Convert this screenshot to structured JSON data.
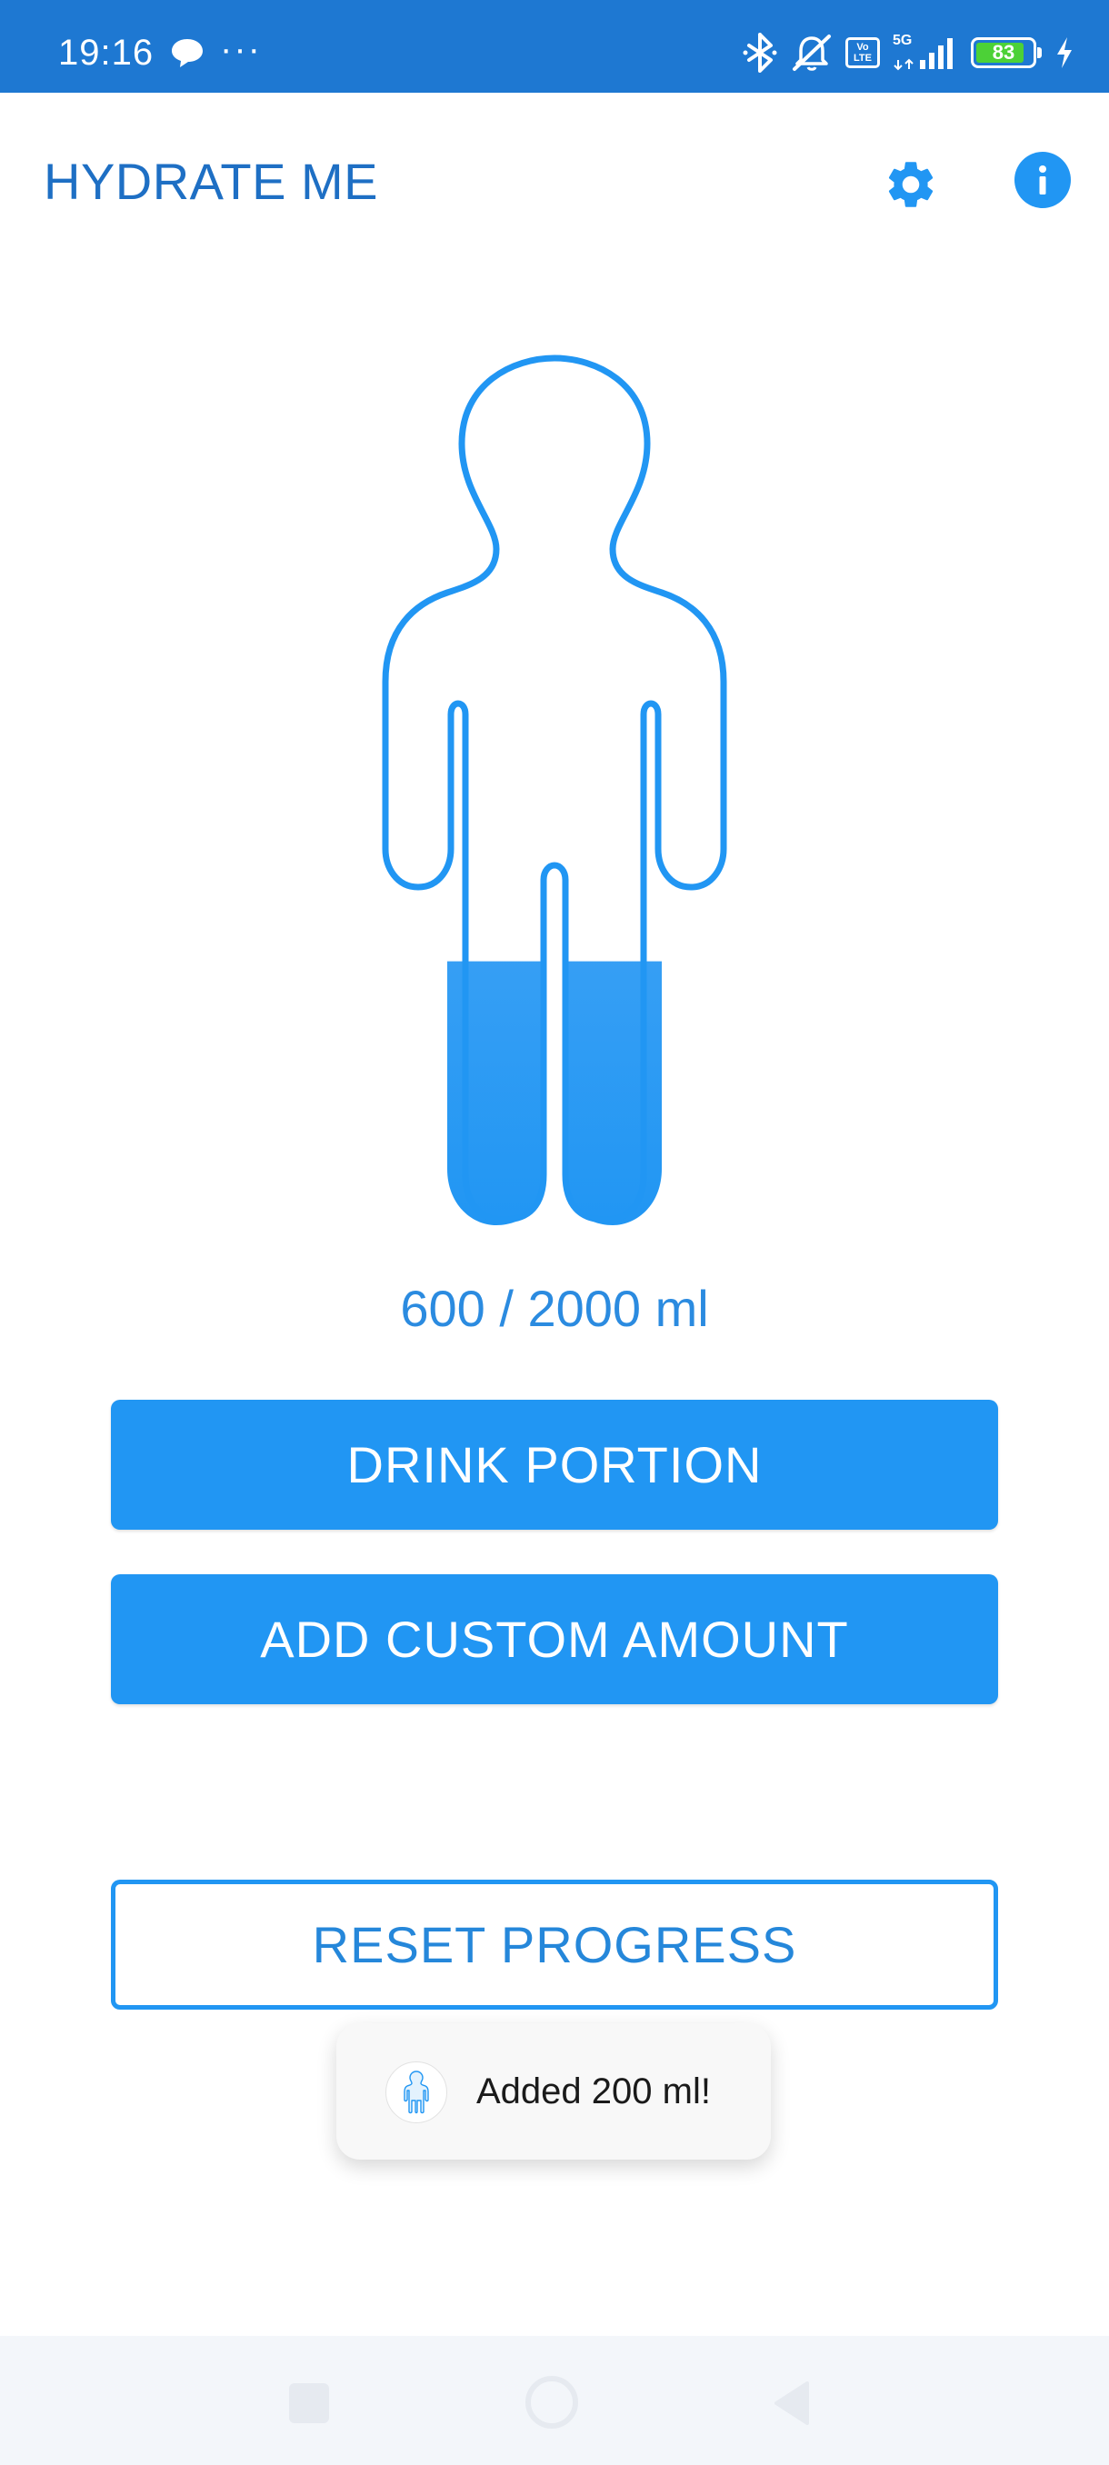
{
  "status_bar": {
    "time": "19:16",
    "more": "···",
    "battery_level": "83",
    "network": "5G",
    "volte": "Vo LTE",
    "icons": [
      "chat-bubble-icon",
      "bluetooth-icon",
      "silent-icon",
      "volte-icon",
      "signal-icon",
      "battery-icon",
      "charging-icon"
    ],
    "background_color": "#1E78D2",
    "battery_color": "#4CD137"
  },
  "app_bar": {
    "title": "HYDRATE ME",
    "settings_icon": "gear-icon",
    "info_icon": "info-icon",
    "title_color": "#1E6FC4"
  },
  "progress": {
    "text": "600 / 2000 ml",
    "current_ml": 600,
    "goal_ml": 2000,
    "fill_color": "#2196F3"
  },
  "actions": {
    "drink_label": "DRINK PORTION",
    "custom_label": "ADD CUSTOM AMOUNT",
    "reset_label": "RESET PROGRESS",
    "primary_color": "#2196F3"
  },
  "toast": {
    "message": "Added 200 ml!",
    "icon": "app-figure-icon"
  },
  "nav_bar": {
    "icons": [
      "recent-apps-icon",
      "home-icon",
      "back-icon"
    ]
  }
}
